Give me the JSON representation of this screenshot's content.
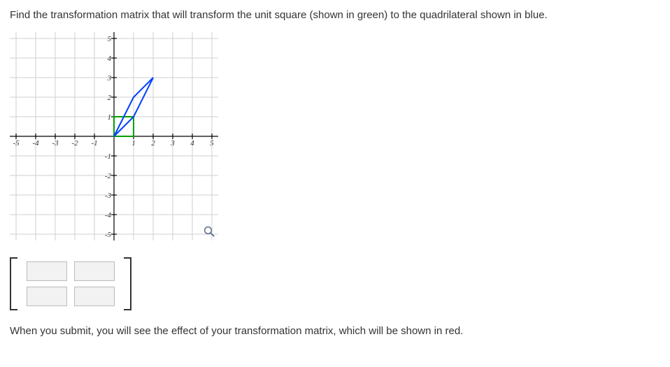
{
  "prompt_text": "Find the transformation matrix that will transform the unit square (shown in green) to the quadrilateral shown in blue.",
  "after_text": "When you submit, you will see the effect of your transformation matrix, which will be shown in red.",
  "matrix_input": {
    "a11": "",
    "a12": "",
    "a21": "",
    "a22": ""
  },
  "chart_data": {
    "type": "plot",
    "xlim": [
      -5,
      5
    ],
    "ylim": [
      -5,
      5
    ],
    "xticks": [
      -5,
      -4,
      -3,
      -2,
      -1,
      1,
      2,
      3,
      4,
      5
    ],
    "yticks": [
      -5,
      -4,
      -3,
      -2,
      -1,
      1,
      2,
      3,
      4,
      5
    ],
    "grid": true,
    "shapes": [
      {
        "name": "unit-square",
        "kind": "polygon",
        "stroke": "#00a000",
        "fill": "none",
        "points": [
          [
            0,
            0
          ],
          [
            1,
            0
          ],
          [
            1,
            1
          ],
          [
            0,
            1
          ]
        ]
      },
      {
        "name": "target-quadrilateral",
        "kind": "polygon",
        "stroke": "#0040ff",
        "fill": "none",
        "points": [
          [
            0,
            0
          ],
          [
            1,
            1
          ],
          [
            2,
            3
          ],
          [
            1,
            2
          ]
        ]
      }
    ]
  },
  "tick_labels": {
    "x_neg5": "-5",
    "x_neg4": "-4",
    "x_neg3": "-3",
    "x_neg2": "-2",
    "x_neg1": "-1",
    "x_1": "1",
    "x_2": "2",
    "x_3": "3",
    "x_4": "4",
    "x_5": "5",
    "y_neg5": "-5",
    "y_neg4": "-4",
    "y_neg3": "-3",
    "y_neg2": "-2",
    "y_neg1": "-1",
    "y_1": "1",
    "y_2": "2",
    "y_3": "3",
    "y_4": "4",
    "y_5": "5"
  }
}
